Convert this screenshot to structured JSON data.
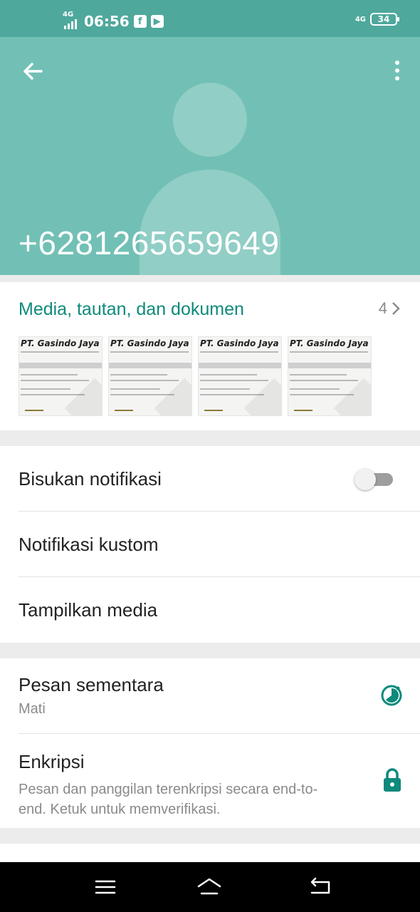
{
  "status_bar": {
    "time": "06:56",
    "signal_label": "4G",
    "network_label": "4G",
    "battery": "34",
    "apps": [
      "facebook-icon",
      "youtube-icon"
    ]
  },
  "header": {
    "phone": "+6281265659649",
    "accent": "#72c0b5"
  },
  "media": {
    "title": "Media, tautan, dan dokumen",
    "count": "4",
    "thumbnails": [
      {
        "heading": "PT. Gasindo Jaya Abadi"
      },
      {
        "heading": "PT. Gasindo Jaya Abadi"
      },
      {
        "heading": "PT. Gasindo Jaya Abadi"
      },
      {
        "heading": "PT. Gasindo Jaya Abadi"
      }
    ]
  },
  "settings": {
    "mute_label": "Bisukan notifikasi",
    "mute_on": false,
    "custom_label": "Notifikasi kustom",
    "media_label": "Tampilkan media"
  },
  "security": {
    "disappearing_label": "Pesan sementara",
    "disappearing_value": "Mati",
    "encryption_label": "Enkripsi",
    "encryption_desc": "Pesan dan panggilan terenkripsi secara end-to-end. Ketuk untuk memverifikasi."
  },
  "colors": {
    "accent_text": "#0e8a7c",
    "status_bar": "#4fa89c"
  }
}
